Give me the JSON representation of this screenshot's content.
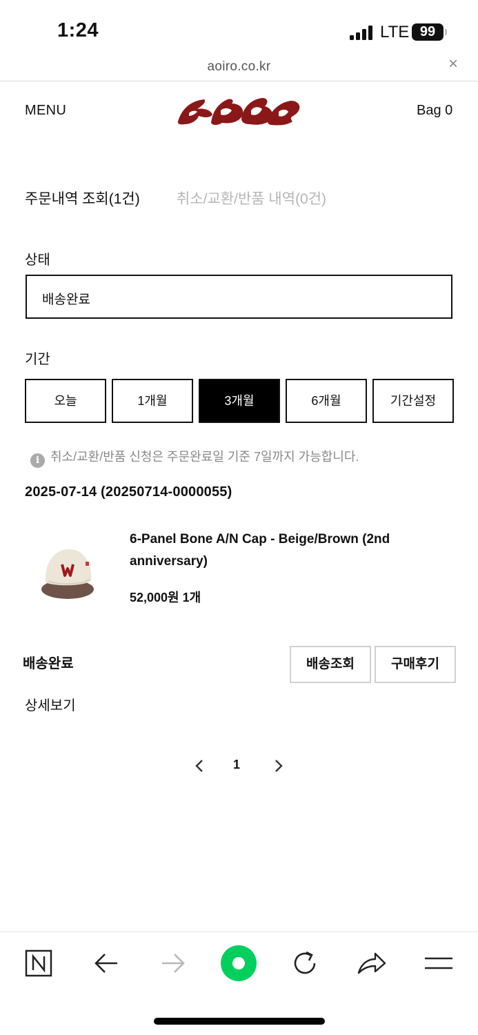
{
  "status_bar": {
    "time": "1:24",
    "network": "LTE",
    "battery": "99"
  },
  "browser": {
    "url": "aoiro.co.kr",
    "close_label": "×"
  },
  "header": {
    "menu_label": "MENU",
    "bag_label": "Bag 0"
  },
  "tabs": {
    "orders": "주문내역 조회(1건)",
    "returns": "취소/교환/반품 내역(0건)"
  },
  "status_filter": {
    "label": "상태",
    "value": "배송완료"
  },
  "period": {
    "label": "기간",
    "options": [
      "오늘",
      "1개월",
      "3개월",
      "6개월",
      "기간설정"
    ],
    "selected": "3개월"
  },
  "notice": {
    "icon": "info-icon",
    "glyph": "i",
    "text": "취소/교환/반품 신청은 주문완료일 기준 7일까지 가능합니다."
  },
  "order": {
    "header": "2025-07-14 (20250714-0000055)",
    "product_name": "6-Panel Bone A/N Cap - Beige/Brown (2nd anniversary)",
    "price_qty": "52,000원 1개",
    "delivery_status": "배송완료",
    "track_button": "배송조회",
    "review_button": "구매후기",
    "detail_link": "상세보기"
  },
  "pagination": {
    "current": "1"
  },
  "bottom_bar": {
    "icons": [
      "naver-home-icon",
      "back-arrow-icon",
      "forward-arrow-icon",
      "green-dot-icon",
      "reload-icon",
      "share-icon",
      "hamburger-menu-icon"
    ]
  },
  "colors": {
    "logo": "#8b1818",
    "green": "#03cf5d",
    "active_period_bg": "#000000"
  }
}
